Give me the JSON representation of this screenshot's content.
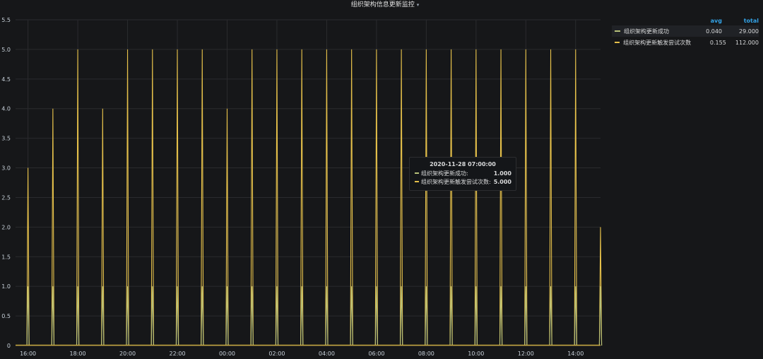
{
  "panel": {
    "title": "组织架构信息更新监控",
    "caret": "▾"
  },
  "legend": {
    "headers": {
      "avg": "avg",
      "total": "total"
    },
    "rows": [
      {
        "name": "组织架构更新成功",
        "avg": "0.040",
        "total": "29.000",
        "color": "#b7c17a"
      },
      {
        "name": "组织架构更新触发尝试次数",
        "avg": "0.155",
        "total": "112.000",
        "color": "#e5c04a"
      }
    ]
  },
  "tooltip": {
    "time": "2020-11-28 07:00:00",
    "rows": [
      {
        "label": "组织架构更新成功:",
        "value": "1.000",
        "color": "#b7c17a"
      },
      {
        "label": "组织架构更新触发尝试次数:",
        "value": "5.000",
        "color": "#e5c04a"
      }
    ]
  },
  "chart_data": {
    "type": "line",
    "x_start": "2020-11-27 15:30",
    "x_end": "2020-11-28 15:00",
    "x_tick_labels": [
      "16:00",
      "18:00",
      "20:00",
      "22:00",
      "00:00",
      "02:00",
      "04:00",
      "06:00",
      "08:00",
      "10:00",
      "12:00",
      "14:00"
    ],
    "y_tick_labels": [
      "0",
      "0.5",
      "1.0",
      "1.5",
      "2.0",
      "2.5",
      "3.0",
      "3.5",
      "4.0",
      "4.5",
      "5.0",
      "5.5"
    ],
    "ylim": [
      0,
      5.5
    ],
    "grid": true,
    "legend_position": "right",
    "series": [
      {
        "name": "组织架构更新触发尝试次数",
        "color": "#e5c04a",
        "points": [
          {
            "x": "2020-11-27 16:00",
            "y": 3
          },
          {
            "x": "2020-11-27 17:00",
            "y": 4
          },
          {
            "x": "2020-11-27 18:00",
            "y": 5
          },
          {
            "x": "2020-11-27 19:00",
            "y": 4
          },
          {
            "x": "2020-11-27 20:00",
            "y": 5
          },
          {
            "x": "2020-11-27 21:00",
            "y": 5
          },
          {
            "x": "2020-11-27 22:00",
            "y": 5
          },
          {
            "x": "2020-11-27 23:00",
            "y": 5
          },
          {
            "x": "2020-11-28 00:00",
            "y": 4
          },
          {
            "x": "2020-11-28 01:00",
            "y": 5
          },
          {
            "x": "2020-11-28 02:00",
            "y": 5
          },
          {
            "x": "2020-11-28 03:00",
            "y": 5
          },
          {
            "x": "2020-11-28 04:00",
            "y": 5
          },
          {
            "x": "2020-11-28 05:00",
            "y": 5
          },
          {
            "x": "2020-11-28 06:00",
            "y": 5
          },
          {
            "x": "2020-11-28 07:00",
            "y": 5
          },
          {
            "x": "2020-11-28 08:00",
            "y": 5
          },
          {
            "x": "2020-11-28 09:00",
            "y": 5
          },
          {
            "x": "2020-11-28 10:00",
            "y": 5
          },
          {
            "x": "2020-11-28 11:00",
            "y": 5
          },
          {
            "x": "2020-11-28 12:00",
            "y": 5
          },
          {
            "x": "2020-11-28 13:00",
            "y": 5
          },
          {
            "x": "2020-11-28 14:00",
            "y": 5
          },
          {
            "x": "2020-11-28 15:00",
            "y": 2
          }
        ]
      },
      {
        "name": "组织架构更新成功",
        "color": "#b7c17a",
        "points": [
          {
            "x": "2020-11-27 16:00",
            "y": 1
          },
          {
            "x": "2020-11-27 17:00",
            "y": 1
          },
          {
            "x": "2020-11-27 18:00",
            "y": 1
          },
          {
            "x": "2020-11-27 19:00",
            "y": 1
          },
          {
            "x": "2020-11-27 20:00",
            "y": 1
          },
          {
            "x": "2020-11-27 21:00",
            "y": 1
          },
          {
            "x": "2020-11-27 22:00",
            "y": 1
          },
          {
            "x": "2020-11-27 23:00",
            "y": 1
          },
          {
            "x": "2020-11-28 00:00",
            "y": 1
          },
          {
            "x": "2020-11-28 01:00",
            "y": 1
          },
          {
            "x": "2020-11-28 02:00",
            "y": 1
          },
          {
            "x": "2020-11-28 03:00",
            "y": 1
          },
          {
            "x": "2020-11-28 04:00",
            "y": 1
          },
          {
            "x": "2020-11-28 05:00",
            "y": 1
          },
          {
            "x": "2020-11-28 06:00",
            "y": 1
          },
          {
            "x": "2020-11-28 07:00",
            "y": 1
          },
          {
            "x": "2020-11-28 08:00",
            "y": 1
          },
          {
            "x": "2020-11-28 09:00",
            "y": 1
          },
          {
            "x": "2020-11-28 10:00",
            "y": 1
          },
          {
            "x": "2020-11-28 11:00",
            "y": 1
          },
          {
            "x": "2020-11-28 12:00",
            "y": 1
          },
          {
            "x": "2020-11-28 13:00",
            "y": 1
          },
          {
            "x": "2020-11-28 14:00",
            "y": 1
          },
          {
            "x": "2020-11-28 15:00",
            "y": 1
          }
        ]
      }
    ]
  }
}
